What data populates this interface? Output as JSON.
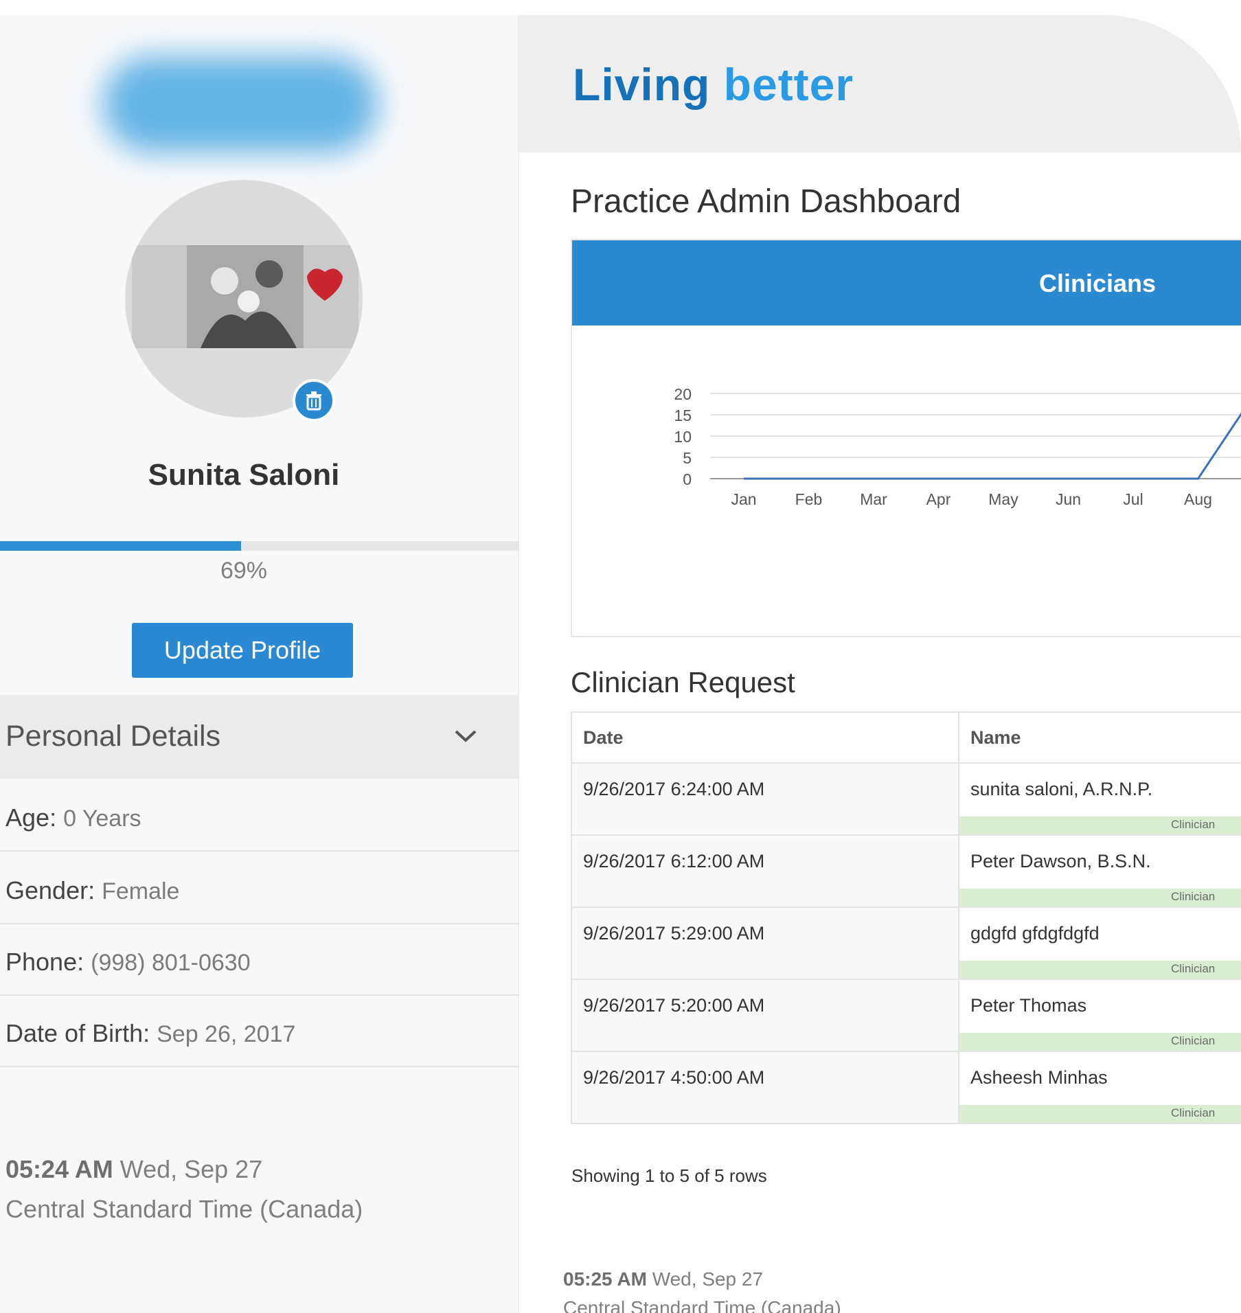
{
  "sidebar": {
    "user_name": "Sunita Saloni",
    "profile_progress_percent": 69,
    "profile_progress_label": "69%",
    "update_button_label": "Update Profile",
    "section_title": "Personal Details",
    "details": [
      {
        "label": "Age",
        "value": "0 Years"
      },
      {
        "label": "Gender",
        "value": "Female"
      },
      {
        "label": "Phone",
        "value": "(998) 801-0630"
      },
      {
        "label": "Date of Birth",
        "value": "Sep 26, 2017"
      }
    ],
    "clock": {
      "time": "05:24 AM",
      "date": "Wed, Sep 27",
      "timezone": "Central Standard Time (Canada)"
    }
  },
  "brand": {
    "word1": "Living",
    "word2": "better"
  },
  "page_title": "Practice Admin Dashboard",
  "chart_data": {
    "type": "line",
    "title": "Clinicians",
    "categories": [
      "Jan",
      "Feb",
      "Mar",
      "Apr",
      "May",
      "Jun",
      "Jul",
      "Aug"
    ],
    "values": [
      0,
      0,
      0,
      0,
      0,
      0,
      0,
      0
    ],
    "continues_after_last_category": {
      "label_visible": false,
      "value_at_edge": 18
    },
    "ylim": [
      0,
      20
    ],
    "yticks": [
      0,
      5,
      10,
      15,
      20
    ],
    "grid": true,
    "series_color": "#3b6fc2"
  },
  "requests": {
    "title": "Clinician Request",
    "columns": [
      "Date",
      "Name"
    ],
    "rows": [
      {
        "date": "9/26/2017 6:24:00 AM",
        "name": "sunita saloni, A.R.N.P.",
        "role": "Clinician"
      },
      {
        "date": "9/26/2017 6:12:00 AM",
        "name": "Peter Dawson, B.S.N.",
        "role": "Clinician"
      },
      {
        "date": "9/26/2017 5:29:00 AM",
        "name": "gdgfd gfdgfdgfd",
        "role": "Clinician"
      },
      {
        "date": "9/26/2017 5:20:00 AM",
        "name": "Peter Thomas",
        "role": "Clinician"
      },
      {
        "date": "9/26/2017 4:50:00 AM",
        "name": "Asheesh Minhas",
        "role": "Clinician"
      }
    ],
    "showing_text": "Showing 1 to 5 of 5 rows"
  },
  "footer_clock": {
    "time": "05:25 AM",
    "date": "Wed, Sep 27",
    "timezone": "Central Standard Time (Canada)"
  },
  "colors": {
    "accent": "#2b88d3",
    "brand_dark": "#1671b8",
    "brand_light": "#2b9ae4",
    "role_bar": "#d8edd2"
  },
  "icons": {
    "delete_photo": "trash-icon",
    "expand": "chevron-down-icon"
  }
}
